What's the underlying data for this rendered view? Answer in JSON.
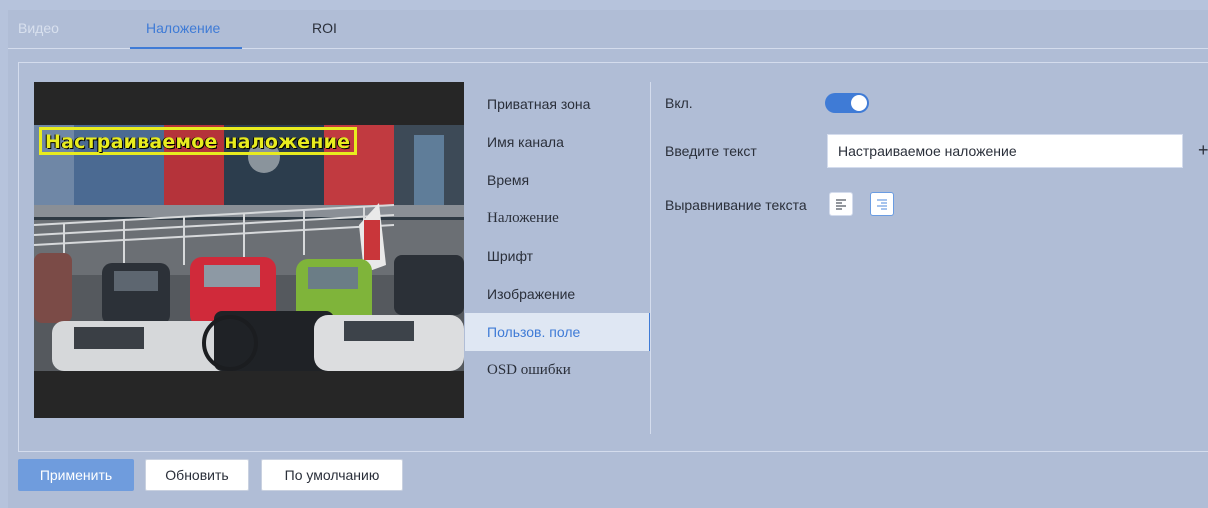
{
  "tabs": [
    {
      "label": "Видео"
    },
    {
      "label": "Наложение"
    },
    {
      "label": "ROI"
    }
  ],
  "preview": {
    "osd_text": "Настраиваемое наложение"
  },
  "menu": {
    "items": [
      {
        "label": "Приватная зона"
      },
      {
        "label": "Имя канала"
      },
      {
        "label": "Время"
      },
      {
        "label": "Наложение"
      },
      {
        "label": "Шрифт"
      },
      {
        "label": "Изображение"
      },
      {
        "label": "Пользов. поле"
      },
      {
        "label": "OSD ошибки"
      }
    ],
    "selected": "Пользов. поле"
  },
  "form": {
    "enable_label": "Вкл.",
    "enable_value": true,
    "text_label": "Введите текст",
    "text_value": "Настраиваемое наложение",
    "add_icon": "plus-icon",
    "alignment_label": "Выравнивание текста",
    "alignment_selected": "right"
  },
  "buttons": {
    "apply": "Применить",
    "refresh": "Обновить",
    "default": "По умолчанию"
  },
  "colors": {
    "accent": "#3f7bd6",
    "osd_text": "#e8ec1f",
    "background": "#b0bdd6"
  }
}
